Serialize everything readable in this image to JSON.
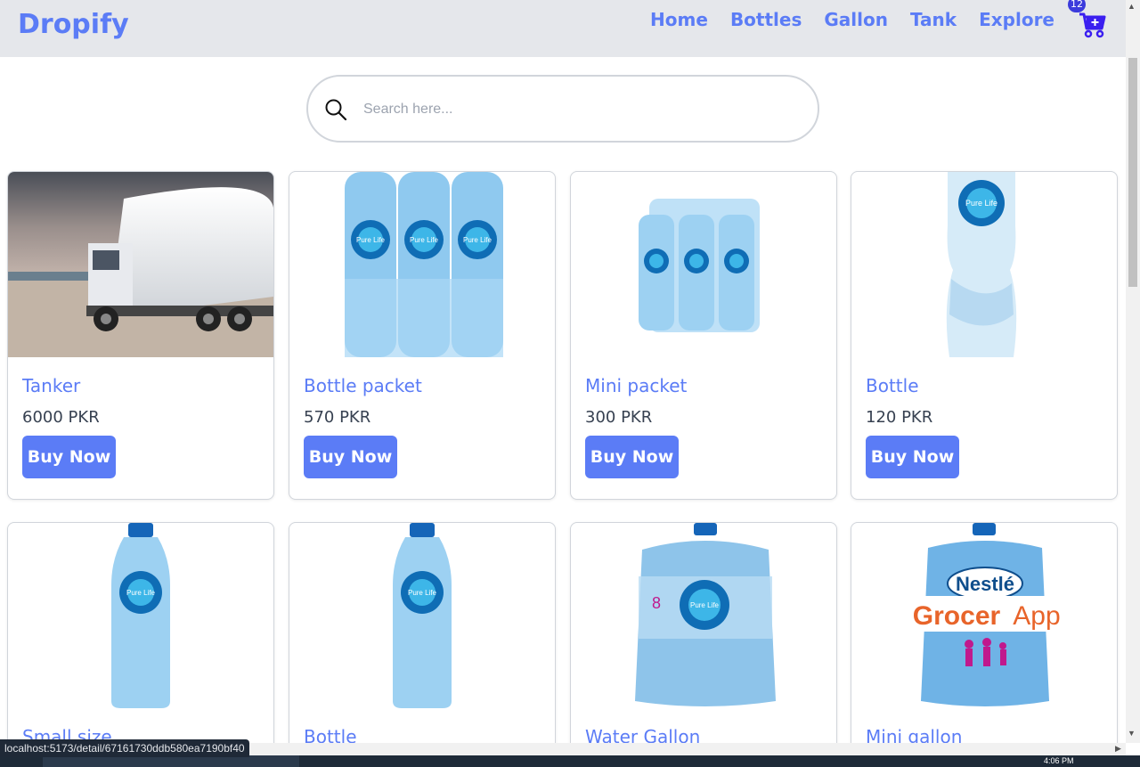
{
  "navbar": {
    "brand": "Dropify",
    "links": [
      "Home",
      "Bottles",
      "Gallon",
      "Tank",
      "Explore"
    ],
    "cart_count": "12"
  },
  "search": {
    "placeholder": "Search here..."
  },
  "products": [
    {
      "title": "Tanker",
      "price": "6000 PKR",
      "button": "Buy Now"
    },
    {
      "title": "Bottle packet",
      "price": "570 PKR",
      "button": "Buy Now"
    },
    {
      "title": "Mini packet",
      "price": "300 PKR",
      "button": "Buy Now"
    },
    {
      "title": "Bottle",
      "price": "120 PKR",
      "button": "Buy Now"
    },
    {
      "title": "Small size"
    },
    {
      "title": "Bottle"
    },
    {
      "title": "Water Gallon"
    },
    {
      "title": "Mini gallon"
    }
  ],
  "image_labels": {
    "brand_nestle": "Nestlé",
    "brand_purelife": "Pure Life",
    "grocer": "Grocer",
    "app": "App"
  },
  "status_bar": {
    "url": "localhost:5173/detail/67161730ddb580ea7190bf40"
  },
  "taskbar": {
    "time": "4:06 PM"
  },
  "colors": {
    "accent": "#5b7cf6",
    "nav_bg": "#e5e7eb",
    "cart": "#3b1ff0"
  }
}
